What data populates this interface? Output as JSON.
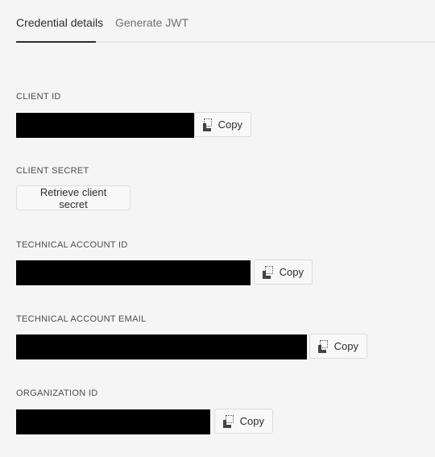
{
  "tabs": [
    {
      "label": "Credential details",
      "active": true
    },
    {
      "label": "Generate JWT",
      "active": false
    }
  ],
  "fields": {
    "client_id": {
      "label": "CLIENT ID",
      "copy_label": "Copy"
    },
    "client_secret": {
      "label": "CLIENT SECRET",
      "button_label": "Retrieve client secret"
    },
    "technical_account_id": {
      "label": "TECHNICAL ACCOUNT ID",
      "copy_label": "Copy"
    },
    "technical_account_email": {
      "label": "TECHNICAL ACCOUNT EMAIL",
      "copy_label": "Copy"
    },
    "organization_id": {
      "label": "ORGANIZATION ID",
      "copy_label": "Copy"
    }
  },
  "icons": {
    "copy": "copy-icon"
  }
}
